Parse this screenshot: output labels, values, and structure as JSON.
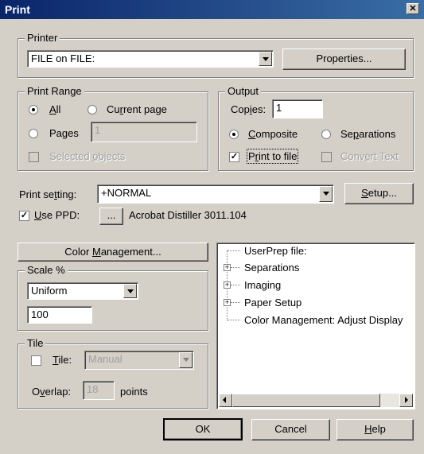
{
  "window": {
    "title": "Print",
    "close_glyph": "✕"
  },
  "printer": {
    "legend": "Printer",
    "selected": "FILE on FILE:",
    "properties_label": "Properties..."
  },
  "print_range": {
    "legend": "Print Range",
    "all_label_u": "A",
    "all_label_rest": "ll",
    "current_label_pre": "Cu",
    "current_label_u": "r",
    "current_label_rest": "rent page",
    "pages_label": "Pages",
    "pages_value": "1",
    "selected_objects_pre": "Selected ",
    "selected_objects_u": "o",
    "selected_objects_rest": "bjects"
  },
  "output": {
    "legend": "Output",
    "copies_label_pre": "Cop",
    "copies_label_u": "i",
    "copies_label_rest": "es:",
    "copies_value": "1",
    "composite_u": "C",
    "composite_rest": "omposite",
    "separations_pre": "Se",
    "separations_u": "p",
    "separations_rest": "arations",
    "print_to_file_pre": "P",
    "print_to_file_u": "r",
    "print_to_file_rest": "int to file",
    "convert_text_pre": "Conv",
    "convert_text_u": "e",
    "convert_text_rest": "rt Text"
  },
  "print_setting": {
    "label_pre": "Print se",
    "label_u": "t",
    "label_rest": "ting:",
    "selected": "+NORMAL",
    "setup_u": "S",
    "setup_rest": "etup..."
  },
  "ppd": {
    "label_u": "U",
    "label_rest": "se PPD:",
    "browse_label": "...",
    "name": "Acrobat Distiller 3011.104"
  },
  "color_management": {
    "pre": "Color ",
    "u": "M",
    "rest": "anagement..."
  },
  "scale": {
    "legend": "Scale %",
    "selected": "Uniform",
    "value": "100"
  },
  "tile": {
    "legend": "Tile",
    "tile_u": "T",
    "tile_rest": "ile:",
    "tile_mode": "Manual",
    "overlap_pre": "O",
    "overlap_u": "v",
    "overlap_rest": "erlap:",
    "overlap_value": "18",
    "overlap_unit": "points"
  },
  "tree": {
    "items": [
      {
        "label": "UserPrep file:",
        "expander": ""
      },
      {
        "label": "Separations",
        "expander": "+"
      },
      {
        "label": "Imaging",
        "expander": "+"
      },
      {
        "label": "Paper Setup",
        "expander": "+"
      },
      {
        "label": "Color Management: Adjust Display",
        "expander": ""
      }
    ]
  },
  "footer": {
    "ok": "OK",
    "cancel": "Cancel",
    "help_u": "H",
    "help_rest": "elp"
  },
  "colors": {
    "face": "#d4d0c8",
    "title_start": "#0a246a",
    "title_end": "#3a6ea5"
  }
}
